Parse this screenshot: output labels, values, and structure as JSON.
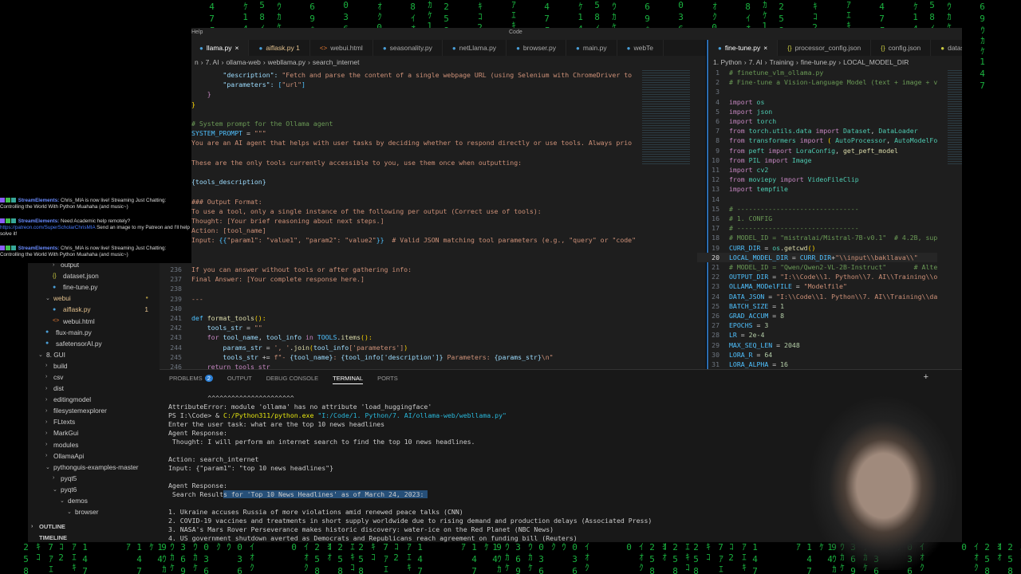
{
  "titlebar": {
    "menu": "Help",
    "search": "Code"
  },
  "tabs_left": [
    {
      "label": "llama.py",
      "active": true,
      "close": "×"
    },
    {
      "label": "aiflask.py 1",
      "mod": true
    },
    {
      "label": "webui.html"
    },
    {
      "label": "seasonality.py"
    },
    {
      "label": "netLlama.py"
    },
    {
      "label": "browser.py"
    },
    {
      "label": "main.py"
    },
    {
      "label": "webTe"
    }
  ],
  "breadcrumb_left": [
    "n",
    "7. AI",
    "ollama-web",
    "webllama.py",
    "search_internet"
  ],
  "tabs_right": [
    {
      "label": "fine-tune.py",
      "active": true,
      "close": "×"
    },
    {
      "label": "processor_config.json"
    },
    {
      "label": "config.json"
    },
    {
      "label": "datas"
    }
  ],
  "breadcrumb_right": [
    "1. Python",
    "7. AI",
    "Training",
    "fine-tune.py",
    "LOCAL_MODEL_DIR"
  ],
  "code_left": {
    "start": 216,
    "lines": [
      [
        [
          "        \"description\": ",
          "va"
        ],
        [
          "\"Fetch and parse the content of a single webpage URL (using Selenium with ChromeDriver to",
          "st"
        ]
      ],
      [
        [
          "        \"parameters\": ",
          "va"
        ],
        [
          "[",
          "co"
        ],
        [
          "\"url\"",
          "st"
        ],
        [
          "]",
          "co"
        ]
      ],
      [
        [
          "    }",
          "kw"
        ]
      ],
      [
        [
          "}",
          "br"
        ]
      ],
      [],
      [
        [
          "# System prompt for the Ollama agent",
          "cm"
        ]
      ],
      [
        [
          "SYSTEM_PROMPT",
          "co"
        ],
        [
          " = ",
          "pl"
        ],
        [
          "\"\"\"",
          "st"
        ]
      ],
      [
        [
          "You are an AI agent that helps with user tasks by deciding whether to respond directly or use tools. Always prio",
          "st"
        ]
      ],
      [],
      [
        [
          "These are the only tools currently accessible to you, use them once when outputting:",
          "st"
        ]
      ],
      [],
      [
        [
          "{tools_description}",
          "va"
        ]
      ],
      [],
      [
        [
          "### Output Format:",
          "st"
        ]
      ],
      [
        [
          "To use a tool, only a single instance of the following per output (Correct use of tools):",
          "st"
        ]
      ],
      [
        [
          "Thought: [Your brief reasoning about next steps.]",
          "st"
        ]
      ],
      [
        [
          "Action: [tool_name]",
          "st"
        ]
      ],
      [
        [
          "Input: ",
          "st"
        ],
        [
          "{{",
          "co"
        ],
        [
          "\"param1\": \"value1\", \"param2\": \"value2\"",
          "st"
        ],
        [
          "}}",
          "co"
        ],
        [
          "  # Valid JSON matching tool parameters (e.g., \"query\" or \"code\"",
          "st"
        ]
      ],
      [],
      [],
      [
        [
          "If you can answer without tools or after gathering info:",
          "st"
        ]
      ],
      [
        [
          "Final Answer: [Your complete response here.]",
          "st"
        ]
      ],
      [],
      [
        [
          "---",
          "st"
        ]
      ],
      [],
      [
        [
          "def ",
          "co"
        ],
        [
          "format_tools",
          "fn"
        ],
        [
          "():",
          "br"
        ]
      ],
      [
        [
          "    tools_str",
          "va"
        ],
        [
          " = ",
          "pl"
        ],
        [
          "\"\"",
          "st"
        ]
      ],
      [
        [
          "    for ",
          "kw"
        ],
        [
          "tool_name",
          "va"
        ],
        [
          ", ",
          "pl"
        ],
        [
          "tool_info",
          "va"
        ],
        [
          " in ",
          "kw"
        ],
        [
          "TOOLS",
          "co"
        ],
        [
          ".",
          "pl"
        ],
        [
          "items",
          "fn"
        ],
        [
          "():",
          "br"
        ]
      ],
      [
        [
          "        params_str",
          "va"
        ],
        [
          " = ",
          "pl"
        ],
        [
          "', '",
          "st"
        ],
        [
          ".",
          "pl"
        ],
        [
          "join",
          "fn"
        ],
        [
          "(",
          "br"
        ],
        [
          "tool_info",
          "va"
        ],
        [
          "['parameters']",
          "st"
        ],
        [
          ")",
          "br"
        ]
      ],
      [
        [
          "        tools_str",
          "va"
        ],
        [
          " += ",
          "pl"
        ],
        [
          "f\"- ",
          "st"
        ],
        [
          "{tool_name}",
          "va"
        ],
        [
          ": ",
          "st"
        ],
        [
          "{tool_info['description']}",
          "va"
        ],
        [
          " Parameters: ",
          "st"
        ],
        [
          "{params_str}",
          "va"
        ],
        [
          "\\n\"",
          "st"
        ]
      ],
      [
        [
          "    return tools_str",
          "kw"
        ]
      ]
    ]
  },
  "code_right": {
    "start": 1,
    "current": 20,
    "lines": [
      [
        [
          "# finetune_vlm_ollama.py",
          "cm"
        ]
      ],
      [
        [
          "# Fine-tune a Vision-Language Model (text + image + v",
          "cm"
        ]
      ],
      [],
      [
        [
          "import ",
          "kw"
        ],
        [
          "os",
          "ty"
        ]
      ],
      [
        [
          "import ",
          "kw"
        ],
        [
          "json",
          "ty"
        ]
      ],
      [
        [
          "import ",
          "kw"
        ],
        [
          "torch",
          "ty"
        ]
      ],
      [
        [
          "from ",
          "kw"
        ],
        [
          "torch.utils.data",
          "ty"
        ],
        [
          " import ",
          "kw"
        ],
        [
          "Dataset",
          "ty"
        ],
        [
          ", ",
          "pl"
        ],
        [
          "DataLoader",
          "ty"
        ]
      ],
      [
        [
          "from ",
          "kw"
        ],
        [
          "transformers",
          "ty"
        ],
        [
          " import ",
          "kw"
        ],
        [
          "( ",
          "br"
        ],
        [
          "AutoProcessor",
          "ty"
        ],
        [
          ", ",
          "pl"
        ],
        [
          "AutoModelFo",
          "ty"
        ]
      ],
      [
        [
          "from ",
          "kw"
        ],
        [
          "peft",
          "ty"
        ],
        [
          " import ",
          "kw"
        ],
        [
          "LoraConfig",
          "ty"
        ],
        [
          ", ",
          "pl"
        ],
        [
          "get_peft_model",
          "fn"
        ]
      ],
      [
        [
          "from ",
          "kw"
        ],
        [
          "PIL",
          "ty"
        ],
        [
          " import ",
          "kw"
        ],
        [
          "Image",
          "ty"
        ]
      ],
      [
        [
          "import ",
          "kw"
        ],
        [
          "cv2",
          "ty"
        ]
      ],
      [
        [
          "from ",
          "kw"
        ],
        [
          "moviepy",
          "ty"
        ],
        [
          " import ",
          "kw"
        ],
        [
          "VideoFileClip",
          "ty"
        ]
      ],
      [
        [
          "import ",
          "kw"
        ],
        [
          "tempfile",
          "ty"
        ]
      ],
      [],
      [
        [
          "# -------------------------------",
          "cm"
        ]
      ],
      [
        [
          "# 1. CONFIG",
          "cm"
        ]
      ],
      [
        [
          "# -------------------------------",
          "cm"
        ]
      ],
      [
        [
          "# MODEL_ID = \"mistralai/Mistral-7B-v0.1\"  # 4.2B, sup",
          "cm"
        ]
      ],
      [
        [
          "CURR_DIR",
          "co"
        ],
        [
          " = ",
          "pl"
        ],
        [
          "os",
          "ty"
        ],
        [
          ".",
          "pl"
        ],
        [
          "getcwd",
          "fn"
        ],
        [
          "()",
          "br"
        ]
      ],
      [
        [
          "LOCAL_MODEL_DIR",
          "co"
        ],
        [
          " = ",
          "pl"
        ],
        [
          "CURR_DIR",
          "co"
        ],
        [
          "+",
          "pl"
        ],
        [
          "\"\\\\input\\\\bakllava\\\\\"",
          "st"
        ]
      ],
      [
        [
          "# MODEL_ID = \"Qwen/Qwen2-VL-2B-Instruct\"       # Alte",
          "cm"
        ]
      ],
      [
        [
          "OUTPUT_DIR",
          "co"
        ],
        [
          " = ",
          "pl"
        ],
        [
          "\"I:\\\\Code\\\\1. Python\\\\7. AI\\\\Training\\\\o",
          "st"
        ]
      ],
      [
        [
          "OLLAMA_MODelFILE",
          "co"
        ],
        [
          " = ",
          "pl"
        ],
        [
          "\"Modelfile\"",
          "st"
        ]
      ],
      [
        [
          "DATA_JSON",
          "co"
        ],
        [
          " = ",
          "pl"
        ],
        [
          "\"I:\\\\Code\\\\1. Python\\\\7. AI\\\\Training\\\\da",
          "st"
        ]
      ],
      [
        [
          "BATCH_SIZE",
          "co"
        ],
        [
          " = ",
          "pl"
        ],
        [
          "1",
          "nu"
        ]
      ],
      [
        [
          "GRAD_ACCUM",
          "co"
        ],
        [
          " = ",
          "pl"
        ],
        [
          "8",
          "nu"
        ]
      ],
      [
        [
          "EPOCHS",
          "co"
        ],
        [
          " = ",
          "pl"
        ],
        [
          "3",
          "nu"
        ]
      ],
      [
        [
          "LR",
          "co"
        ],
        [
          " = ",
          "pl"
        ],
        [
          "2e-4",
          "nu"
        ]
      ],
      [
        [
          "MAX_SEQ_LEN",
          "co"
        ],
        [
          " = ",
          "pl"
        ],
        [
          "2048",
          "nu"
        ]
      ],
      [
        [
          "LORA_R",
          "co"
        ],
        [
          " = ",
          "pl"
        ],
        [
          "64",
          "nu"
        ]
      ],
      [
        [
          "LORA_ALPHA",
          "co"
        ],
        [
          " = ",
          "pl"
        ],
        [
          "16",
          "nu"
        ]
      ]
    ]
  },
  "panel": {
    "tabs": [
      "PROBLEMS",
      "OUTPUT",
      "DEBUG CONSOLE",
      "TERMINAL",
      "PORTS"
    ],
    "problems_count": "2",
    "active": "TERMINAL"
  },
  "terminal": [
    [
      [
        "          ^^^^^^^^^^^^^^^^^^^^^^",
        ""
      ]
    ],
    [
      [
        "AttributeError: module 'ollama' has no attribute 'load_huggingface'",
        ""
      ]
    ],
    [
      [
        "PS I:\\Code> & ",
        ""
      ],
      [
        "C:/Python311/python.exe",
        "yl"
      ],
      [
        " \"I:/Code/1. Python/7. AI/ollama-web/webllama.py\"",
        "cy"
      ]
    ],
    [
      [
        "Enter the user task: what are the top 10 news headlines",
        ""
      ]
    ],
    [
      [
        "Agent Response:",
        ""
      ]
    ],
    [
      [
        " Thought: I will perform an internet search to find the top 10 news headlines.",
        ""
      ]
    ],
    [],
    [
      [
        "Action: search_internet",
        ""
      ]
    ],
    [
      [
        "Input: {\"param1\": \"top 10 news headlines\"}",
        ""
      ]
    ],
    [],
    [
      [
        "Agent Response:",
        ""
      ]
    ],
    [
      [
        " Search Result",
        ""
      ],
      [
        "s for 'Top 10 News Headlines' as of March 24, 2023: ",
        "sel"
      ]
    ],
    [],
    [
      [
        "1. Ukraine accuses Russia of more violations amid renewed peace talks (CNN)",
        ""
      ]
    ],
    [
      [
        "2. COVID-19 vaccines and treatments in short supply worldwide due to rising demand and production delays (Associated Press)",
        ""
      ]
    ],
    [
      [
        "3. NASA's Mars Rover Perseverance makes historic discovery: water-ice on the Red Planet (NBC News)",
        ""
      ]
    ],
    [
      [
        "4. US government shutdown averted as Democrats and Republicans reach agreement on funding bill (Reuters)",
        ""
      ]
    ]
  ],
  "explorer": [
    {
      "label": "output",
      "depth": 3,
      "type": "folder",
      "open": false
    },
    {
      "label": "dataset.json",
      "depth": 3,
      "type": "json"
    },
    {
      "label": "fine-tune.py",
      "depth": 3,
      "type": "py"
    },
    {
      "label": "webui",
      "depth": 2,
      "type": "folder",
      "open": true,
      "mod": true
    },
    {
      "label": "aiflask.py",
      "depth": 3,
      "type": "py",
      "mod": true,
      "badge": "1"
    },
    {
      "label": "webui.html",
      "depth": 3,
      "type": "html"
    },
    {
      "label": "flux-main.py",
      "depth": 2,
      "type": "py"
    },
    {
      "label": "safetensorAI.py",
      "depth": 2,
      "type": "py"
    },
    {
      "label": "8. GUI",
      "depth": 1,
      "type": "folder",
      "open": true
    },
    {
      "label": "build",
      "depth": 2,
      "type": "folder",
      "open": false
    },
    {
      "label": "csv",
      "depth": 2,
      "type": "folder",
      "open": false
    },
    {
      "label": "dist",
      "depth": 2,
      "type": "folder",
      "open": false
    },
    {
      "label": "editingmodel",
      "depth": 2,
      "type": "folder",
      "open": false
    },
    {
      "label": "filesystemexplorer",
      "depth": 2,
      "type": "folder",
      "open": false
    },
    {
      "label": "FLtexts",
      "depth": 2,
      "type": "folder",
      "open": false
    },
    {
      "label": "MarkGui",
      "depth": 2,
      "type": "folder",
      "open": false
    },
    {
      "label": "modules",
      "depth": 2,
      "type": "folder",
      "open": false
    },
    {
      "label": "OllamaApi",
      "depth": 2,
      "type": "folder",
      "open": false
    },
    {
      "label": "pythonguis-examples-master",
      "depth": 2,
      "type": "folder",
      "open": true
    },
    {
      "label": "pyqt5",
      "depth": 3,
      "type": "folder",
      "open": false
    },
    {
      "label": "pyqt6",
      "depth": 3,
      "type": "folder",
      "open": true
    },
    {
      "label": "demos",
      "depth": 4,
      "type": "folder",
      "open": true
    },
    {
      "label": "browser",
      "depth": 5,
      "type": "folder",
      "open": true
    }
  ],
  "sections": {
    "outline": "OUTLINE",
    "timeline": "TIMELINE"
  },
  "chat": [
    {
      "user": "StreamElements:",
      "text": " Chris_MIA is now live! Streaming Just Chatting: Controlling the World With Python Muahaha (and music~)"
    },
    {
      "user": "StreamElements:",
      "text": " Need Academic help remotely?",
      "link": "https://patreon.com/SuperScholarChrisMIA",
      "text2": " Send an image to my Patreon and I'll help solve it!"
    },
    {
      "user": "StreamElements:",
      "text": " Chris_MIA is now live! Streaming Just Chatting: Controlling the World With Python Muahaha (and music~)"
    }
  ],
  "colors": {
    "accent": "#2c7fd4",
    "matrix": "#1fd14a",
    "editor_bg": "#1e1e1e"
  }
}
